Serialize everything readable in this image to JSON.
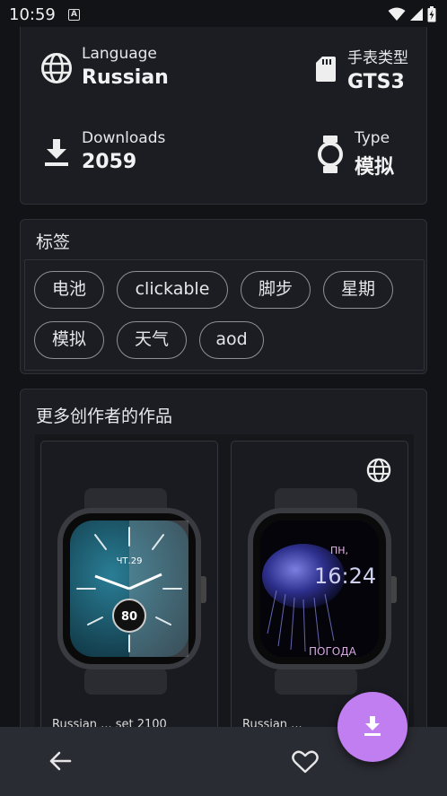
{
  "status_bar": {
    "time": "10:59",
    "notif_letter": "A"
  },
  "info": {
    "language_label": "Language",
    "language_value": "Russian",
    "watch_type_label": "手表类型",
    "watch_type_value": "GTS3",
    "downloads_label": "Downloads",
    "downloads_value": "2059",
    "type_label": "Type",
    "type_value": "模拟"
  },
  "tags": {
    "title": "标签",
    "items": [
      "电池",
      "clickable",
      "脚步",
      "星期",
      "模拟",
      "天气",
      "aod"
    ]
  },
  "more": {
    "title": "更多创作者的作品",
    "tiles": [
      {
        "date": "ЧТ.29",
        "value": "80",
        "name": "Russian ... set 2100"
      },
      {
        "day": "ПН,",
        "time": "16:24",
        "weather": "ПОГОДА",
        "name": "Russian ..."
      }
    ]
  }
}
